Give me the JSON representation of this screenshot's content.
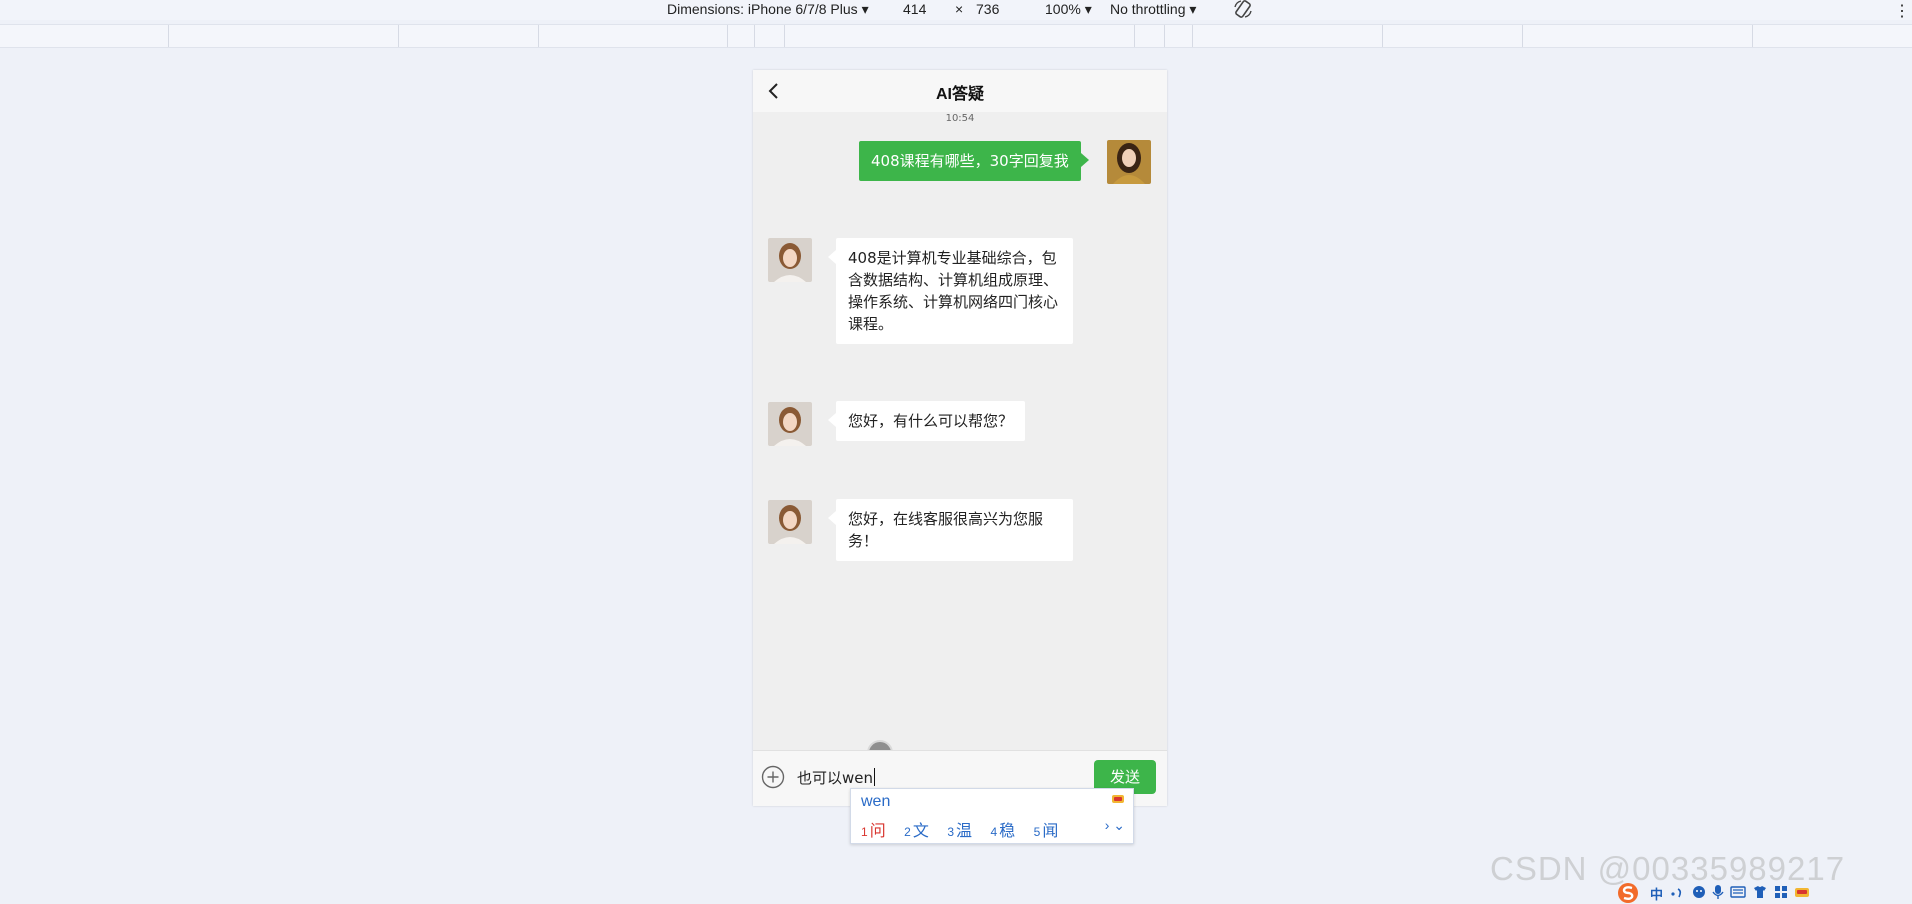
{
  "devtools": {
    "dimensions_label": "Dimensions: iPhone 6/7/8 Plus",
    "width": "414",
    "times": "×",
    "height": "736",
    "zoom": "100%",
    "throttling": "No throttling",
    "dropdown_arrow": "▾"
  },
  "header": {
    "title": "AI答疑"
  },
  "chat": {
    "time": "10:54",
    "messages": [
      {
        "from": "user",
        "text": "408课程有哪些，30字回复我"
      },
      {
        "from": "bot",
        "text": "408是计算机专业基础综合，包含数据结构、计算机组成原理、操作系统、计算机网络四门核心课程。"
      },
      {
        "from": "bot",
        "text": "您好，有什么可以帮您？"
      },
      {
        "from": "bot",
        "text": "您好，在线客服很高兴为您服务！"
      }
    ]
  },
  "footer": {
    "input_value": "也可以wen",
    "send_label": "发送"
  },
  "ime": {
    "composition": "wen",
    "candidates": [
      {
        "n": "1",
        "text": "问"
      },
      {
        "n": "2",
        "text": "文"
      },
      {
        "n": "3",
        "text": "温"
      },
      {
        "n": "4",
        "text": "稳"
      },
      {
        "n": "5",
        "text": "闻"
      }
    ],
    "next": "›",
    "expand": "⌄"
  },
  "watermark": "CSDN @00335989217",
  "tray": {
    "lang": "中"
  },
  "colors": {
    "accent": "#3db54a",
    "page_bg": "#eef1f8",
    "chat_bg": "#efefef"
  }
}
